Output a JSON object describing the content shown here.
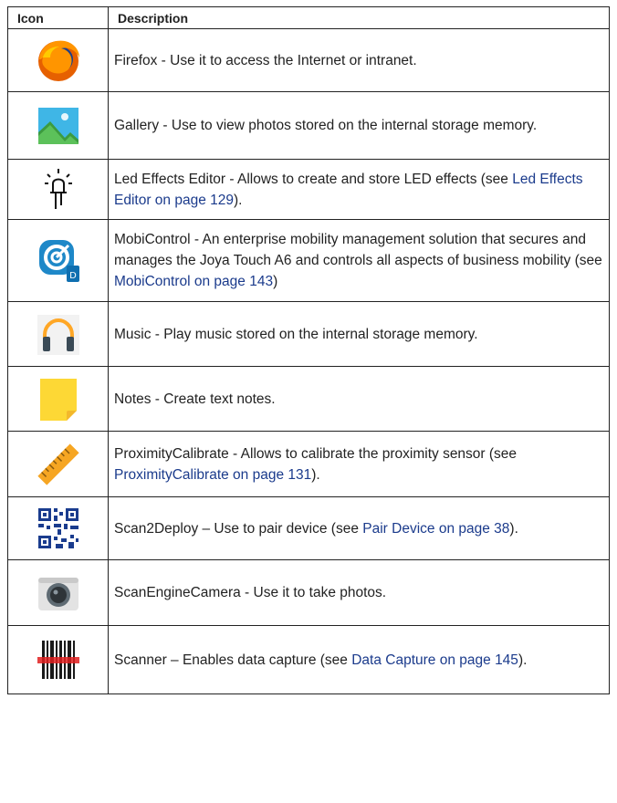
{
  "table": {
    "headers": {
      "icon": "Icon",
      "description": "Description"
    },
    "rows": [
      {
        "icon": "firefox-icon",
        "text": "Firefox - Use it to access the Internet or intranet."
      },
      {
        "icon": "gallery-icon",
        "text": "Gallery - Use to view photos stored on the internal storage memory."
      },
      {
        "icon": "led-effects-editor-icon",
        "text": "Led Effects Editor - Allows to create and store LED effects (see ",
        "link": "Led Effects Editor on page 129",
        "after": ")."
      },
      {
        "icon": "mobicontrol-icon",
        "text": "MobiControl - An enterprise mobility management solution that secures and manages the Joya Touch A6 and controls all aspects of business mobility (see ",
        "link": "MobiControl on page 143",
        "after": ")"
      },
      {
        "icon": "music-icon",
        "text": "Music - Play music stored on the internal storage memory."
      },
      {
        "icon": "notes-icon",
        "text": "Notes - Create text notes."
      },
      {
        "icon": "proximity-calibrate-icon",
        "text": "ProximityCalibrate - Allows to calibrate the proximity sensor (see ",
        "link": "ProximityCalibrate on page 131",
        "after": ")."
      },
      {
        "icon": "scan2deploy-icon",
        "text": "Scan2Deploy – Use to pair device (see ",
        "link": "Pair Device on page 38",
        "after": ")."
      },
      {
        "icon": "scan-engine-camera-icon",
        "text": "ScanEngineCamera - Use it to take photos."
      },
      {
        "icon": "scanner-icon",
        "text": "Scanner – Enables data capture (see ",
        "link": "Data Capture on page 145",
        "after": ")."
      }
    ]
  },
  "colors": {
    "link": "#1b3b8c",
    "border": "#222222"
  }
}
